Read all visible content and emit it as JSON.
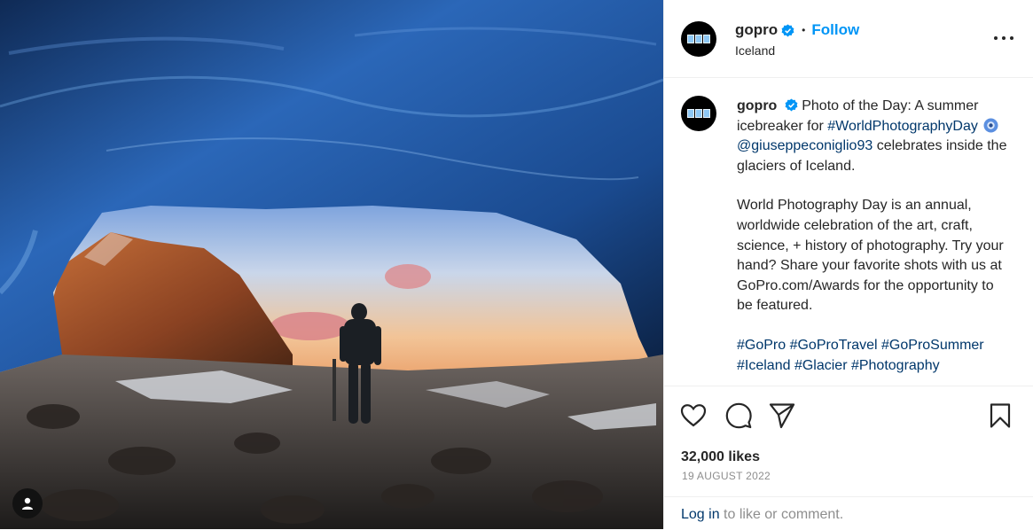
{
  "header": {
    "username": "gopro",
    "separator": "•",
    "follow_label": "Follow",
    "location": "Iceland"
  },
  "caption": {
    "username": "gopro",
    "line1": "Photo of the Day: A summer icebreaker for",
    "hashtag_day": "#WorldPhotographyDay",
    "mention": "@giuseppeconiglio93",
    "line2": "celebrates inside the glaciers of Iceland.",
    "paragraph2": "World Photography Day is an annual, worldwide celebration of the art, craft, science, + history of photography. Try your hand? Share your favorite shots with us at GoPro.com/Awards for the opportunity to be featured.",
    "hashtags": "#GoPro #GoProTravel #GoProSummer #Iceland #Glacier #Photography"
  },
  "icons": {
    "like": "heart-icon",
    "comment": "comment-icon",
    "share": "paper-plane-icon",
    "save": "bookmark-icon",
    "more": "more-options-icon",
    "tags": "user-tag-icon",
    "verified": "verified-badge-icon",
    "emoji": "camera-emoji-icon"
  },
  "stats": {
    "likes": "32,000 likes",
    "date": "19 AUGUST 2022"
  },
  "footer": {
    "login_label": "Log in",
    "login_rest": " to like or comment."
  },
  "colors": {
    "link_blue": "#0095f6",
    "hashtag_navy": "#00376b",
    "muted": "#8e8e8e",
    "verified": "#0095f6"
  }
}
